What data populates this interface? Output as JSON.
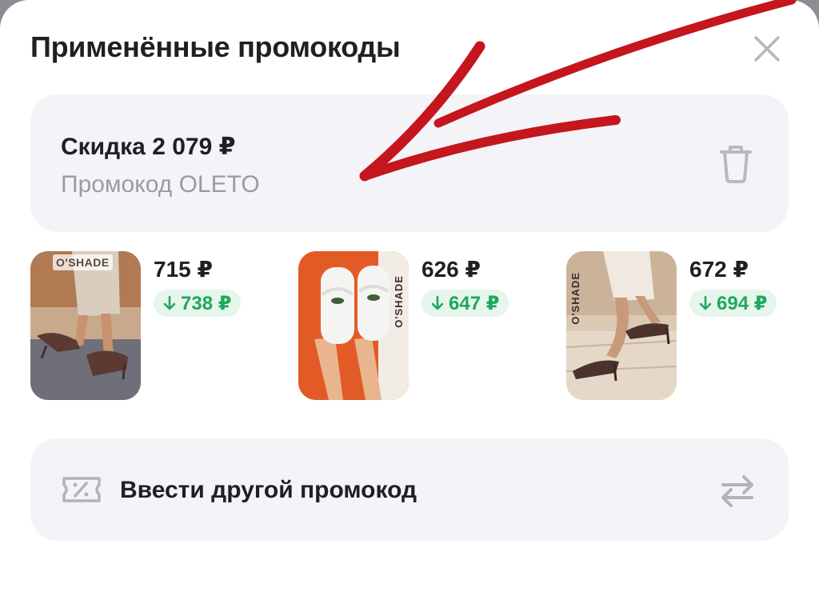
{
  "header": {
    "title": "Применённые промокоды"
  },
  "applied_promo": {
    "discount_text": "Скидка 2 079 ₽",
    "code_text": "Промокод OLETO"
  },
  "products": [
    {
      "brand": "O'SHADE",
      "price": "715 ₽",
      "old_price": "738 ₽"
    },
    {
      "brand": "O'SHADE",
      "price": "626 ₽",
      "old_price": "647 ₽"
    },
    {
      "brand": "O'SHADE",
      "price": "672 ₽",
      "old_price": "694 ₽"
    }
  ],
  "enter_other": {
    "label": "Ввести другой промокод"
  },
  "icons": [
    "close-icon",
    "trash-icon",
    "down-arrow-icon",
    "coupon-icon",
    "swap-icon"
  ],
  "colors": {
    "accent_green": "#1fa85a",
    "badge_green_bg": "#e6f6ec",
    "card_bg": "#f4f3f7",
    "muted_text": "#9a9aa6",
    "annotation_red": "#c4161c"
  }
}
